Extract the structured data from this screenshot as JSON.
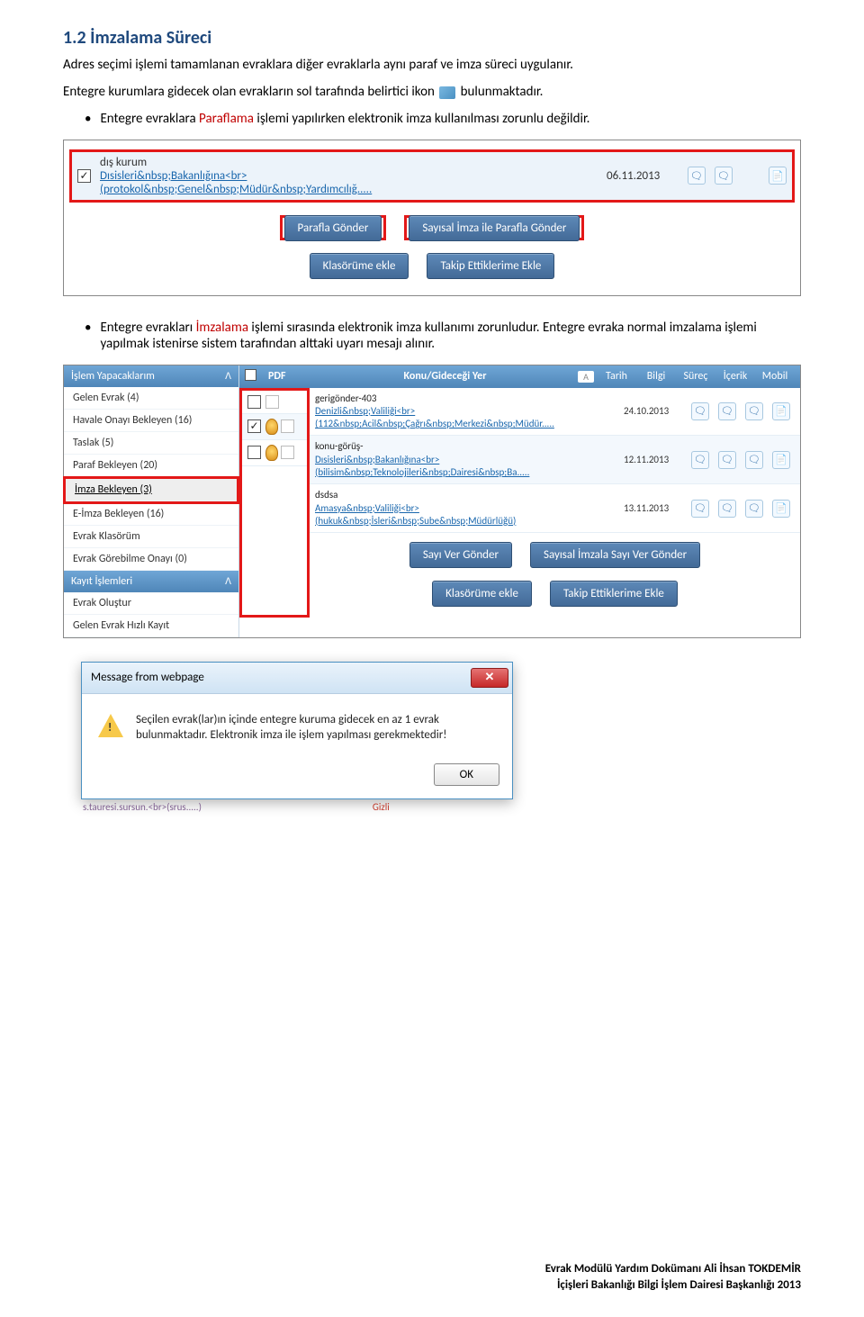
{
  "heading": "1.2   İmzalama Süreci",
  "para1": "Adres seçimi işlemi tamamlanan evraklara diğer evraklarla aynı paraf ve imza süreci uygulanır.",
  "para2_pre": "Entegre kurumlara gidecek olan evrakların sol tarafında belirtici ikon ",
  "para2_post": " bulunmaktadır.",
  "bullet1_a": "Entegre evraklara ",
  "bullet1_b": "Paraflama",
  "bullet1_c": " işlemi yapılırken elektronik imza kullanılması zorunlu değildir.",
  "s1": {
    "kurum": "dış kurum",
    "link": "Dısisleri&nbsp;Bakanlığına<br>",
    "sub": "(protokol&nbsp;Genel&nbsp;Müdür&nbsp;Yardımcılığ.....",
    "date": "06.11.2013",
    "btn_parafla": "Parafla Gönder",
    "btn_sayisal": "Sayısal İmza ile Parafla Gönder",
    "btn_klasor": "Klasörüme ekle",
    "btn_takip": "Takip Ettiklerime Ekle"
  },
  "bullet2_a": "Entegre evrakları ",
  "bullet2_b": "İmzalama",
  "bullet2_c": " işlemi sırasında elektronik imza kullanımı zorunludur. Entegre evraka normal imzalama işlemi yapılmak istenirse sistem tarafından alttaki uyarı mesajı alınır.",
  "s2": {
    "panel1": "İşlem Yapacaklarım",
    "items1": [
      "Gelen Evrak (4)",
      "Havale Onayı Bekleyen (16)",
      "Taslak (5)",
      "Paraf Bekleyen (20)"
    ],
    "item_sel": "İmza Bekleyen (3)",
    "items2": [
      "E-İmza Bekleyen (16)",
      "Evrak Klasörüm",
      "Evrak Görebilme Onayı (0)"
    ],
    "panel2": "Kayıt İşlemleri",
    "items3": [
      "Evrak Oluştur",
      "Gelen Evrak Hızlı Kayıt"
    ],
    "th_pdf": "PDF",
    "th_konu": "Konu/Gideceği Yer",
    "th_tarih": "Tarih",
    "th_bilgi": "Bilgi",
    "th_surec": "Süreç",
    "th_icerik": "İçerik",
    "th_mobil": "Mobil",
    "rows": [
      {
        "t": "gerigönder-403",
        "l": "Denizli&nbsp;Valiliği<br>",
        "s": "(112&nbsp;Acil&nbsp;Çağrı&nbsp;Merkezi&nbsp;Müdür.....",
        "d": "24.10.2013",
        "chk": false,
        "ribbon": false
      },
      {
        "t": "konu-görüş-",
        "l": "Dısisleri&nbsp;Bakanlığına<br>",
        "s": "(bilisim&nbsp;Teknolojileri&nbsp;Dairesi&nbsp;Ba.....",
        "d": "12.11.2013",
        "chk": true,
        "ribbon": true
      },
      {
        "t": "dsdsa",
        "l": "Amasya&nbsp;Valiliği<br>",
        "s": "(hukuk&nbsp;İsleri&nbsp;Sube&nbsp;Müdürlüğü)",
        "d": "13.11.2013",
        "chk": false,
        "ribbon": true
      }
    ],
    "btn_sayi": "Sayı Ver Gönder",
    "btn_sayisal": "Sayısal İmzala Sayı Ver Gönder",
    "btn_klasor": "Klasörüme ekle",
    "btn_takip": "Takip Ettiklerime Ekle"
  },
  "dlg": {
    "title": "Message from webpage",
    "msg": "Seçilen evrak(lar)ın içinde entegre kuruma gidecek en az 1 evrak bulunmaktadır. Elektronik imza ile işlem yapılması gerekmektedir!",
    "ok": "OK"
  },
  "under_left": "s.tauresi.sursun.<br>(srus.....)",
  "under_right": "Gizli",
  "footer1": "Evrak Modülü Yardım Dokümanı Ali İhsan TOKDEMİR",
  "footer2": "İçişleri Bakanlığı Bilgi İşlem Dairesi Başkanlığı 2013"
}
